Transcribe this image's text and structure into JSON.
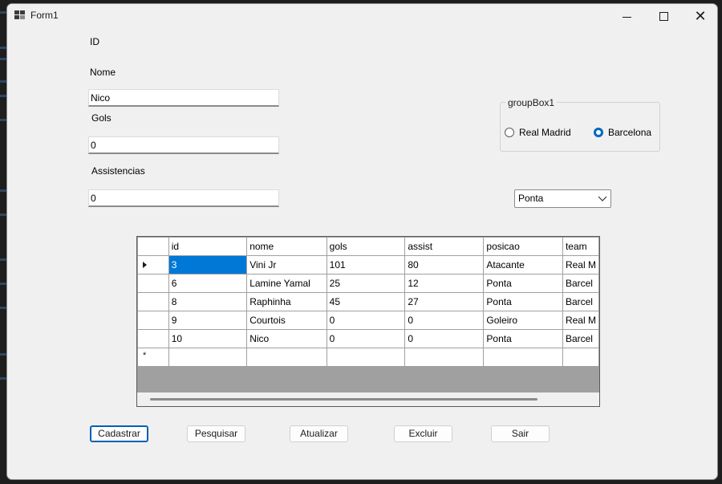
{
  "window": {
    "title": "Form1"
  },
  "form": {
    "id_label": "ID",
    "nome_label": "Nome",
    "nome_value": "Nico",
    "gols_label": "Gols",
    "gols_value": "0",
    "assist_label": "Assistencias",
    "assist_value": "0"
  },
  "groupbox": {
    "title": "groupBox1",
    "options": [
      {
        "label": "Real Madrid",
        "checked": false
      },
      {
        "label": "Barcelona",
        "checked": true
      }
    ]
  },
  "combo": {
    "selected": "Ponta"
  },
  "grid": {
    "columns": [
      "id",
      "nome",
      "gols",
      "assist",
      "posicao",
      "team"
    ],
    "rows": [
      [
        "3",
        "Vini Jr",
        "101",
        "80",
        "Atacante",
        "Real M"
      ],
      [
        "6",
        "Lamine Yamal",
        "25",
        "12",
        "Ponta",
        "Barcel"
      ],
      [
        "8",
        "Raphinha",
        "45",
        "27",
        "Ponta",
        "Barcel"
      ],
      [
        "9",
        "Courtois",
        "0",
        "0",
        "Goleiro",
        "Real M"
      ],
      [
        "10",
        "Nico",
        "0",
        "0",
        "Ponta",
        "Barcel"
      ]
    ],
    "new_row_marker": "*"
  },
  "buttons": {
    "cadastrar": "Cadastrar",
    "pesquisar": "Pesquisar",
    "atualizar": "Atualizar",
    "excluir": "Excluir",
    "sair": "Sair"
  }
}
